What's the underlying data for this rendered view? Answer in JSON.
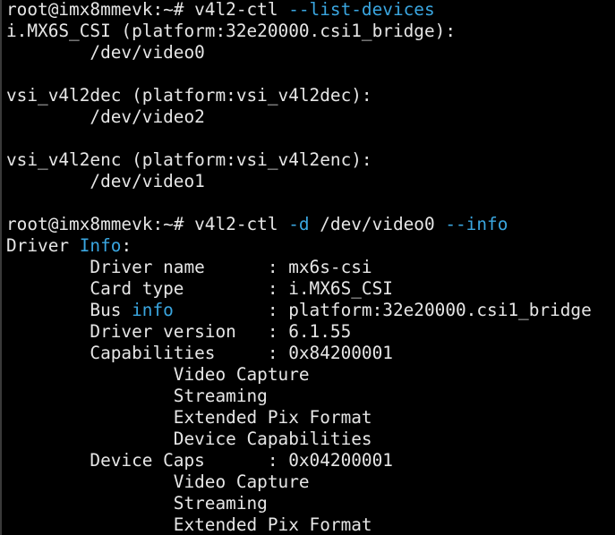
{
  "theme": {
    "background": "#000000",
    "foreground": "#e6e6e6",
    "highlight": "#3aa6e0"
  },
  "lines": [
    [
      {
        "t": "root@imx8mmevk:~# v4l2-ctl ",
        "c": "plain"
      },
      {
        "t": "--list-devices",
        "c": "hl"
      }
    ],
    [
      {
        "t": "i.MX6S_CSI (platform:32e20000.csi1_bridge):",
        "c": "plain"
      }
    ],
    [
      {
        "t": "        /dev/video0",
        "c": "plain"
      }
    ],
    [],
    [
      {
        "t": "vsi_v4l2dec (platform:vsi_v4l2dec):",
        "c": "plain"
      }
    ],
    [
      {
        "t": "        /dev/video2",
        "c": "plain"
      }
    ],
    [],
    [
      {
        "t": "vsi_v4l2enc (platform:vsi_v4l2enc):",
        "c": "plain"
      }
    ],
    [
      {
        "t": "        /dev/video1",
        "c": "plain"
      }
    ],
    [],
    [
      {
        "t": "root@imx8mmevk:~# v4l2-ctl ",
        "c": "plain"
      },
      {
        "t": "-d",
        "c": "hl"
      },
      {
        "t": " /dev/video0 ",
        "c": "plain"
      },
      {
        "t": "--info",
        "c": "hl"
      }
    ],
    [
      {
        "t": "Driver ",
        "c": "plain"
      },
      {
        "t": "Info",
        "c": "hl"
      },
      {
        "t": ":",
        "c": "plain"
      }
    ],
    [
      {
        "t": "        Driver name      : mx6s-csi",
        "c": "plain"
      }
    ],
    [
      {
        "t": "        Card type        : i.MX6S_CSI",
        "c": "plain"
      }
    ],
    [
      {
        "t": "        Bus ",
        "c": "plain"
      },
      {
        "t": "info",
        "c": "hl"
      },
      {
        "t": "         : platform:32e20000.csi1_bridge",
        "c": "plain"
      }
    ],
    [
      {
        "t": "        Driver version   : 6.1.55",
        "c": "plain"
      }
    ],
    [
      {
        "t": "        Capabilities     : 0x84200001",
        "c": "plain"
      }
    ],
    [
      {
        "t": "                Video Capture",
        "c": "plain"
      }
    ],
    [
      {
        "t": "                Streaming",
        "c": "plain"
      }
    ],
    [
      {
        "t": "                Extended Pix Format",
        "c": "plain"
      }
    ],
    [
      {
        "t": "                Device Capabilities",
        "c": "plain"
      }
    ],
    [
      {
        "t": "        Device Caps      : 0x04200001",
        "c": "plain"
      }
    ],
    [
      {
        "t": "                Video Capture",
        "c": "plain"
      }
    ],
    [
      {
        "t": "                Streaming",
        "c": "plain"
      }
    ],
    [
      {
        "t": "                Extended Pix Format",
        "c": "plain"
      }
    ]
  ]
}
